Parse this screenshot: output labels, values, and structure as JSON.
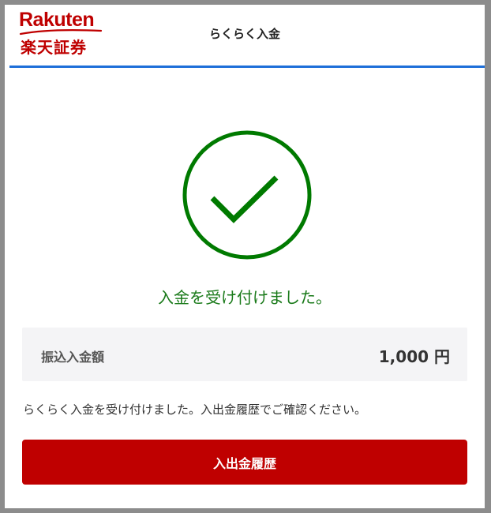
{
  "logo": {
    "wordmark": "Rakuten",
    "kanji": "楽天証券"
  },
  "header": {
    "title": "らくらく入金"
  },
  "status": {
    "icon": "checkmark-circle-icon",
    "message": "入金を受け付けました。"
  },
  "transfer": {
    "label": "振込入金額",
    "amount": "1,000 円"
  },
  "info": {
    "text": "らくらく入金を受け付けました。入出金履歴でご確認ください。"
  },
  "actions": {
    "history_label": "入出金履歴"
  },
  "colors": {
    "brand": "#bf0000",
    "accent_rule": "#1e6fd9",
    "success": "#1a7a1a"
  }
}
